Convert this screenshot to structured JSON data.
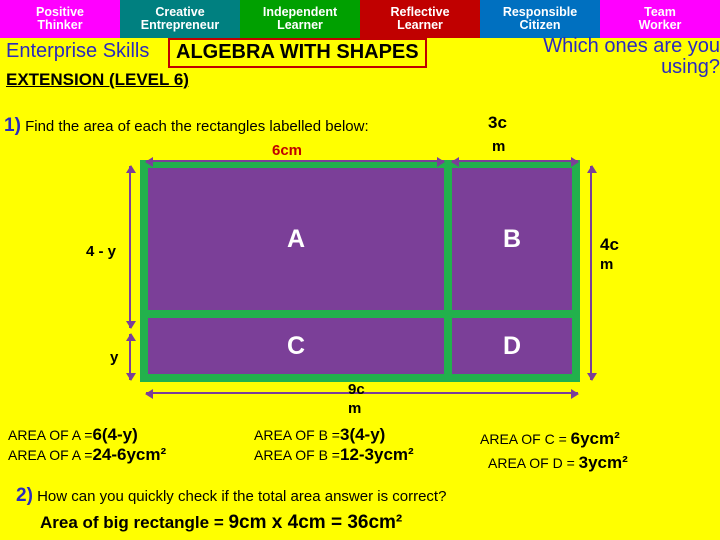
{
  "skillbar": {
    "items": [
      {
        "lines": [
          "Positive",
          "Thinker"
        ],
        "bg": "#ff00ff",
        "color": "#ffffff"
      },
      {
        "lines": [
          "Creative",
          "Entrepreneur"
        ],
        "bg": "#008080",
        "color": "#ffffff"
      },
      {
        "lines": [
          "Independent",
          "Learner"
        ],
        "bg": "#00a000",
        "color": "#ffffff"
      },
      {
        "lines": [
          "Reflective",
          "Learner"
        ],
        "bg": "#c00000",
        "color": "#ffffff"
      },
      {
        "lines": [
          "Responsible",
          "Citizen"
        ],
        "bg": "#0070c0",
        "color": "#ffffff"
      },
      {
        "lines": [
          "Team",
          "Worker"
        ],
        "bg": "#ff00ff",
        "color": "#ffffff"
      }
    ]
  },
  "header": {
    "enterprise": "Enterprise Skills",
    "title": "ALGEBRA WITH SHAPES",
    "which_line1": "Which ones are you",
    "which_line2": "using?",
    "extension": "EXTENSION (LEVEL 6)"
  },
  "question1": {
    "number": "1)",
    "text": "Find the area of each the rectangles labelled below:"
  },
  "diagram": {
    "cells": [
      {
        "label": "A"
      },
      {
        "label": "B"
      },
      {
        "label": "C"
      },
      {
        "label": "D"
      }
    ],
    "dims": {
      "top_left": "6cm",
      "top_right_line1": "3c",
      "top_right_line2": "m",
      "left_upper": "4 - y",
      "left_lower": "y",
      "right_line1": "4c",
      "right_line2": "m",
      "bottom_line1": "9c",
      "bottom_line2": "m"
    }
  },
  "answers": {
    "a1_label": "AREA OF A =",
    "a1_value": "6(4-y)",
    "a2_label": "AREA OF A =",
    "a2_value": "24-6ycm²",
    "b1_label": "AREA OF B =",
    "b1_value": "3(4-y)",
    "b2_label": "AREA OF B =",
    "b2_value": "12-3ycm²",
    "c_label": "AREA OF C =",
    "c_value": "6ycm²",
    "d_label": "AREA OF D =",
    "d_value": "3ycm²"
  },
  "question2": {
    "number": "2)",
    "text": "How can you quickly check if the total area answer is correct?",
    "final_prefix": "Area of big rectangle = ",
    "final_value": "9cm x 4cm = 36cm²"
  },
  "colors": {
    "page_bg": "#ffff00",
    "rect_fill": "#7b3f98",
    "rect_border": "#22b14c",
    "accent_blue": "#2b2bbd",
    "title_box_border": "#c00000"
  }
}
